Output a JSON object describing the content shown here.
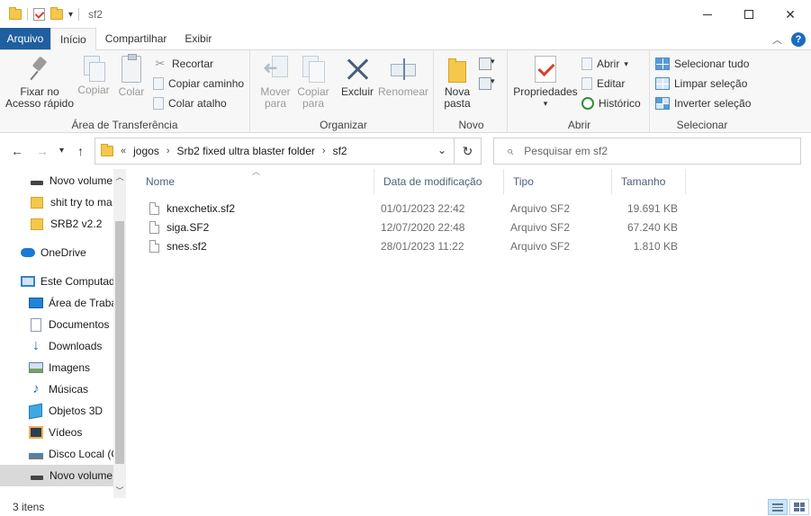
{
  "window": {
    "title": "sf2",
    "controls": [
      "minimize-icon",
      "maximize-icon",
      "close-icon"
    ]
  },
  "tabs": [
    {
      "label": "Arquivo"
    },
    {
      "label": "Início"
    },
    {
      "label": "Compartilhar"
    },
    {
      "label": "Exibir"
    }
  ],
  "ribbon": {
    "clipboard": {
      "label": "Área de Transferência",
      "pin": "Fixar no Acesso rápido",
      "pin_line1": "Fixar no",
      "pin_line2": "Acesso rápido",
      "copy": "Copiar",
      "paste": "Colar",
      "cut": "Recortar",
      "copy_path": "Copiar caminho",
      "paste_shortcut": "Colar atalho"
    },
    "organize": {
      "label": "Organizar",
      "move_line1": "Mover",
      "move_line2": "para",
      "copy_line1": "Copiar",
      "copy_line2": "para",
      "delete": "Excluir",
      "rename": "Renomear"
    },
    "new": {
      "label": "Novo",
      "folder_line1": "Nova",
      "folder_line2": "pasta"
    },
    "open": {
      "label": "Abrir",
      "properties": "Propriedades",
      "open": "Abrir",
      "edit": "Editar",
      "history": "Histórico"
    },
    "select": {
      "label": "Selecionar",
      "select_all": "Selecionar tudo",
      "select_none": "Limpar seleção",
      "invert": "Inverter seleção"
    }
  },
  "address": {
    "prefix": "«",
    "crumbs": [
      "jogos",
      "Srb2 fixed ultra blaster folder",
      "sf2"
    ],
    "search_placeholder": "Pesquisar em sf2"
  },
  "sidebar": {
    "items": [
      {
        "label": "Novo volume",
        "icon": "drive-icon"
      },
      {
        "label": "shit try to ma",
        "icon": "folder-icon"
      },
      {
        "label": "SRB2 v2.2",
        "icon": "folder-icon"
      },
      {
        "label": "OneDrive",
        "icon": "cloud-icon"
      },
      {
        "label": "Este Computad",
        "icon": "computer-icon"
      },
      {
        "label": "Área de Traba",
        "icon": "desktop-icon"
      },
      {
        "label": "Documentos",
        "icon": "documents-icon"
      },
      {
        "label": "Downloads",
        "icon": "download-icon"
      },
      {
        "label": "Imagens",
        "icon": "pictures-icon"
      },
      {
        "label": "Músicas",
        "icon": "music-icon"
      },
      {
        "label": "Objetos 3D",
        "icon": "objects-3d-icon"
      },
      {
        "label": "Vídeos",
        "icon": "videos-icon"
      },
      {
        "label": "Disco Local (C",
        "icon": "local-disk-icon"
      },
      {
        "label": "Novo volume",
        "icon": "drive-icon"
      }
    ]
  },
  "columns": {
    "name": "Nome",
    "date": "Data de modificação",
    "type": "Tipo",
    "size": "Tamanho"
  },
  "files": [
    {
      "name": "knexchetix.sf2",
      "date": "01/01/2023 22:42",
      "type": "Arquivo SF2",
      "size": "19.691 KB"
    },
    {
      "name": "siga.SF2",
      "date": "12/07/2020 22:48",
      "type": "Arquivo SF2",
      "size": "67.240 KB"
    },
    {
      "name": "snes.sf2",
      "date": "28/01/2023 11:22",
      "type": "Arquivo SF2",
      "size": "1.810 KB"
    }
  ],
  "status": {
    "count": "3 itens"
  },
  "colors": {
    "file_tab": "#1f5f9f",
    "accent": "#1a6cc0",
    "folder": "#f5c74a"
  }
}
